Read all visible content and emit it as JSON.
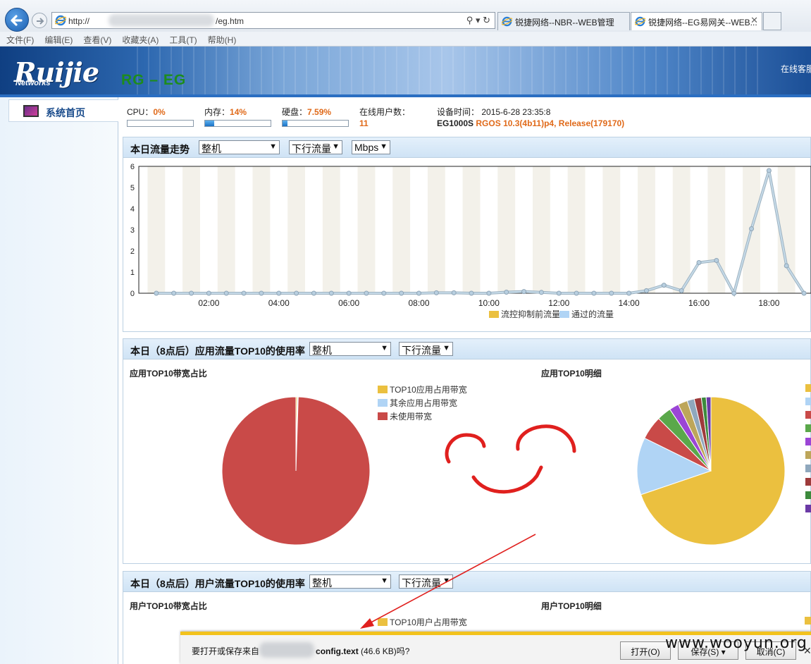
{
  "browser": {
    "url_prefix": "http://",
    "url_suffix": "/eg.htm",
    "tabs": [
      {
        "label": "锐捷网络--NBR--WEB管理"
      },
      {
        "label": "锐捷网络--EG易网关--WEB..."
      }
    ],
    "menu": [
      "文件(F)",
      "编辑(E)",
      "查看(V)",
      "收藏夹(A)",
      "工具(T)",
      "帮助(H)"
    ]
  },
  "header": {
    "logo": "Ruijie",
    "logo_sub": "Networks",
    "product": "RG – EG",
    "online_service": "在线客服"
  },
  "sidebar": {
    "items": [
      {
        "label": "系统首页"
      }
    ]
  },
  "status": {
    "cpu_label": "CPU：",
    "cpu_value": "0%",
    "cpu_fraction": 0.0,
    "mem_label": "内存：",
    "mem_value": "14%",
    "mem_fraction": 0.14,
    "disk_label": "硬盘：",
    "disk_value": "7.59%",
    "disk_fraction": 0.0759,
    "users_label": "在线用户数：",
    "users_value": "11",
    "time_label": "设备时间：",
    "time_value": "2015-6-28 23:35:8",
    "device_model": "EG1000S",
    "device_version": "RGOS 10.3(4b11)p4, Release(179170)"
  },
  "traffic_panel": {
    "title": "本日流量走势",
    "device_select": "整机",
    "direction_select": "下行流量",
    "unit_select": "Mbps"
  },
  "app_panel": {
    "title": "本日（8点后）应用流量TOP10的使用率",
    "device_select": "整机",
    "direction_select": "下行流量",
    "left_subtitle": "应用TOP10带宽占比",
    "right_subtitle": "应用TOP10明细"
  },
  "user_panel": {
    "title": "本日（8点后）用户流量TOP10的使用率",
    "device_select": "整机",
    "direction_select": "下行流量",
    "left_subtitle": "用户TOP10带宽占比",
    "right_subtitle": "用户TOP10明细",
    "legend_first": "TOP10用户占用带宽"
  },
  "dialog": {
    "question_prefix": "要打开或保存来自",
    "file_name": "config.text",
    "file_size": "(46.6 KB)吗?",
    "open_button": "打开(O)",
    "save_button": "保存(S)",
    "cancel_button": "取消(C)"
  },
  "watermark": "www.wooyun.org",
  "colors": {
    "gold": "#ebc03f",
    "lightblue": "#b0d4f5",
    "red": "#c94a48",
    "accent": "#e06a1a",
    "annotation": "#e0201e"
  },
  "chart_data": [
    {
      "type": "line",
      "title": "",
      "x_ticks": [
        "02:00",
        "04:00",
        "06:00",
        "08:00",
        "10:00",
        "12:00",
        "14:00",
        "16:00",
        "18:00"
      ],
      "ylim": [
        0,
        6
      ],
      "y_ticks": [
        0,
        1,
        2,
        3,
        4,
        5,
        6
      ],
      "x_hours": [
        0.5,
        1.0,
        1.5,
        2.0,
        2.5,
        3.0,
        3.5,
        4.0,
        4.5,
        5.0,
        5.5,
        6.0,
        6.5,
        7.0,
        7.5,
        8.0,
        8.5,
        9.0,
        9.5,
        10.0,
        10.5,
        11.0,
        11.5,
        12.0,
        12.5,
        13.0,
        13.5,
        14.0,
        14.5,
        15.0,
        15.5,
        16.0,
        16.5,
        17.0,
        17.5,
        18.0,
        18.5,
        19.0
      ],
      "series": [
        {
          "name": "流控抑制前流量",
          "color": "#ebc03f",
          "values": [
            0,
            0,
            0,
            0,
            0,
            0,
            0,
            0,
            0,
            0,
            0,
            0,
            0,
            0,
            0,
            0,
            0.02,
            0.02,
            0,
            0,
            0.05,
            0.08,
            0.04,
            0,
            0,
            0,
            0,
            0,
            0.12,
            0.38,
            0.12,
            1.45,
            1.55,
            0,
            3.05,
            5.8,
            1.3,
            0
          ]
        },
        {
          "name": "通过的流量",
          "color": "#b0d4f5",
          "values": [
            0,
            0,
            0,
            0,
            0,
            0,
            0,
            0,
            0,
            0,
            0,
            0,
            0,
            0,
            0,
            0,
            0.02,
            0.02,
            0,
            0,
            0.05,
            0.08,
            0.04,
            0,
            0,
            0,
            0,
            0,
            0.12,
            0.38,
            0.12,
            1.45,
            1.55,
            0,
            3.05,
            5.8,
            1.3,
            0
          ]
        }
      ],
      "grid": true,
      "legend_position": "bottom"
    },
    {
      "type": "pie",
      "title": "应用TOP10带宽占比",
      "labels": [
        "TOP10应用占用带宽",
        "其余应用占用带宽",
        "未使用带宽"
      ],
      "values": [
        0.3,
        0.2,
        99.5
      ],
      "colors": [
        "#ebc03f",
        "#b0d4f5",
        "#c94a48"
      ],
      "legend_position": "top-right"
    },
    {
      "type": "pie",
      "title": "应用TOP10明细",
      "values": [
        67,
        12,
        5,
        3,
        2,
        2,
        1.5,
        1.5,
        1,
        1
      ],
      "colors": [
        "#ebc03f",
        "#b0d4f5",
        "#c94a48",
        "#5aa84a",
        "#9b45d6",
        "#bda65a",
        "#8fa8bd",
        "#9e3b3b",
        "#3c8a3c",
        "#6b3aa6"
      ]
    }
  ]
}
